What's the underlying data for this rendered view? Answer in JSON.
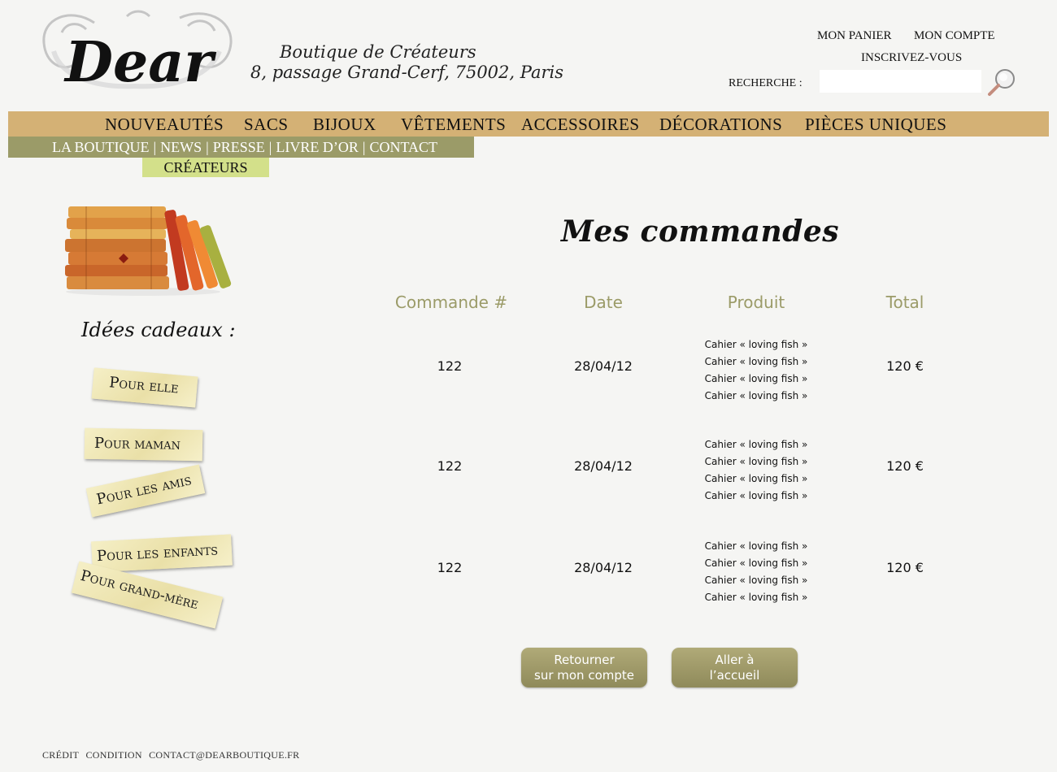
{
  "brand": {
    "logo_text": "Dear",
    "tagline_line1": "Boutique de Créateurs",
    "tagline_line2": "8, passage Grand-Cerf, 75002, Paris"
  },
  "header": {
    "cart": "MON PANIER",
    "account": "MON COMPTE",
    "register": "INSCRIVEZ-VOUS",
    "search_label": "RECHERCHE :",
    "search_value": "",
    "search_icon": "magnifier-icon"
  },
  "main_nav": [
    "NOUVEAUTÉS",
    "SACS",
    "BIJOUX",
    "VÊTEMENTS",
    "ACCESSOIRES",
    "DÉCORATIONS",
    "PIÈCES UNIQUES"
  ],
  "sub_nav": [
    "LA BOUTIQUE",
    "NEWS",
    "PRESSE",
    "LIVRE D’OR",
    "CONTACT"
  ],
  "sub_nav_separator": "|",
  "creators": "CRÉATEURS",
  "sidebar": {
    "ideas_title": "Idées cadeaux :",
    "gifts": [
      "Pour elle",
      "Pour maman",
      "Pour les amis",
      "Pour les enfants",
      "Pour grand-mère"
    ]
  },
  "orders": {
    "title": "Mes commandes",
    "headers": [
      "Commande #",
      "Date",
      "Produit",
      "Total"
    ],
    "rows": [
      {
        "number": "122",
        "date": "28/04/12",
        "products": [
          "Cahier « loving fish »",
          "Cahier « loving fish »",
          "Cahier « loving fish »",
          "Cahier « loving fish »"
        ],
        "total": "120 €"
      },
      {
        "number": "122",
        "date": "28/04/12",
        "products": [
          "Cahier « loving fish »",
          "Cahier « loving fish »",
          "Cahier « loving fish »",
          "Cahier « loving fish »"
        ],
        "total": "120 €"
      },
      {
        "number": "122",
        "date": "28/04/12",
        "products": [
          "Cahier « loving fish »",
          "Cahier « loving fish »",
          "Cahier « loving fish »",
          "Cahier « loving fish »"
        ],
        "total": "120 €"
      }
    ]
  },
  "buttons": {
    "back_line1": "Retourner",
    "back_line2": "sur mon compte",
    "home_line1": "Aller à",
    "home_line2": "l’accueil"
  },
  "footer": {
    "credit": "CRÉDIT",
    "condition": "CONDITION",
    "contact": "CONTACT@DEARBOUTIQUE.FR"
  },
  "colors": {
    "background": "#f5f5f3",
    "main_nav": "#d4b175",
    "sub_nav": "#9b9b68",
    "creators": "#d3e08a",
    "accent_text": "#9b9b68",
    "button": "#9f9a6a"
  }
}
